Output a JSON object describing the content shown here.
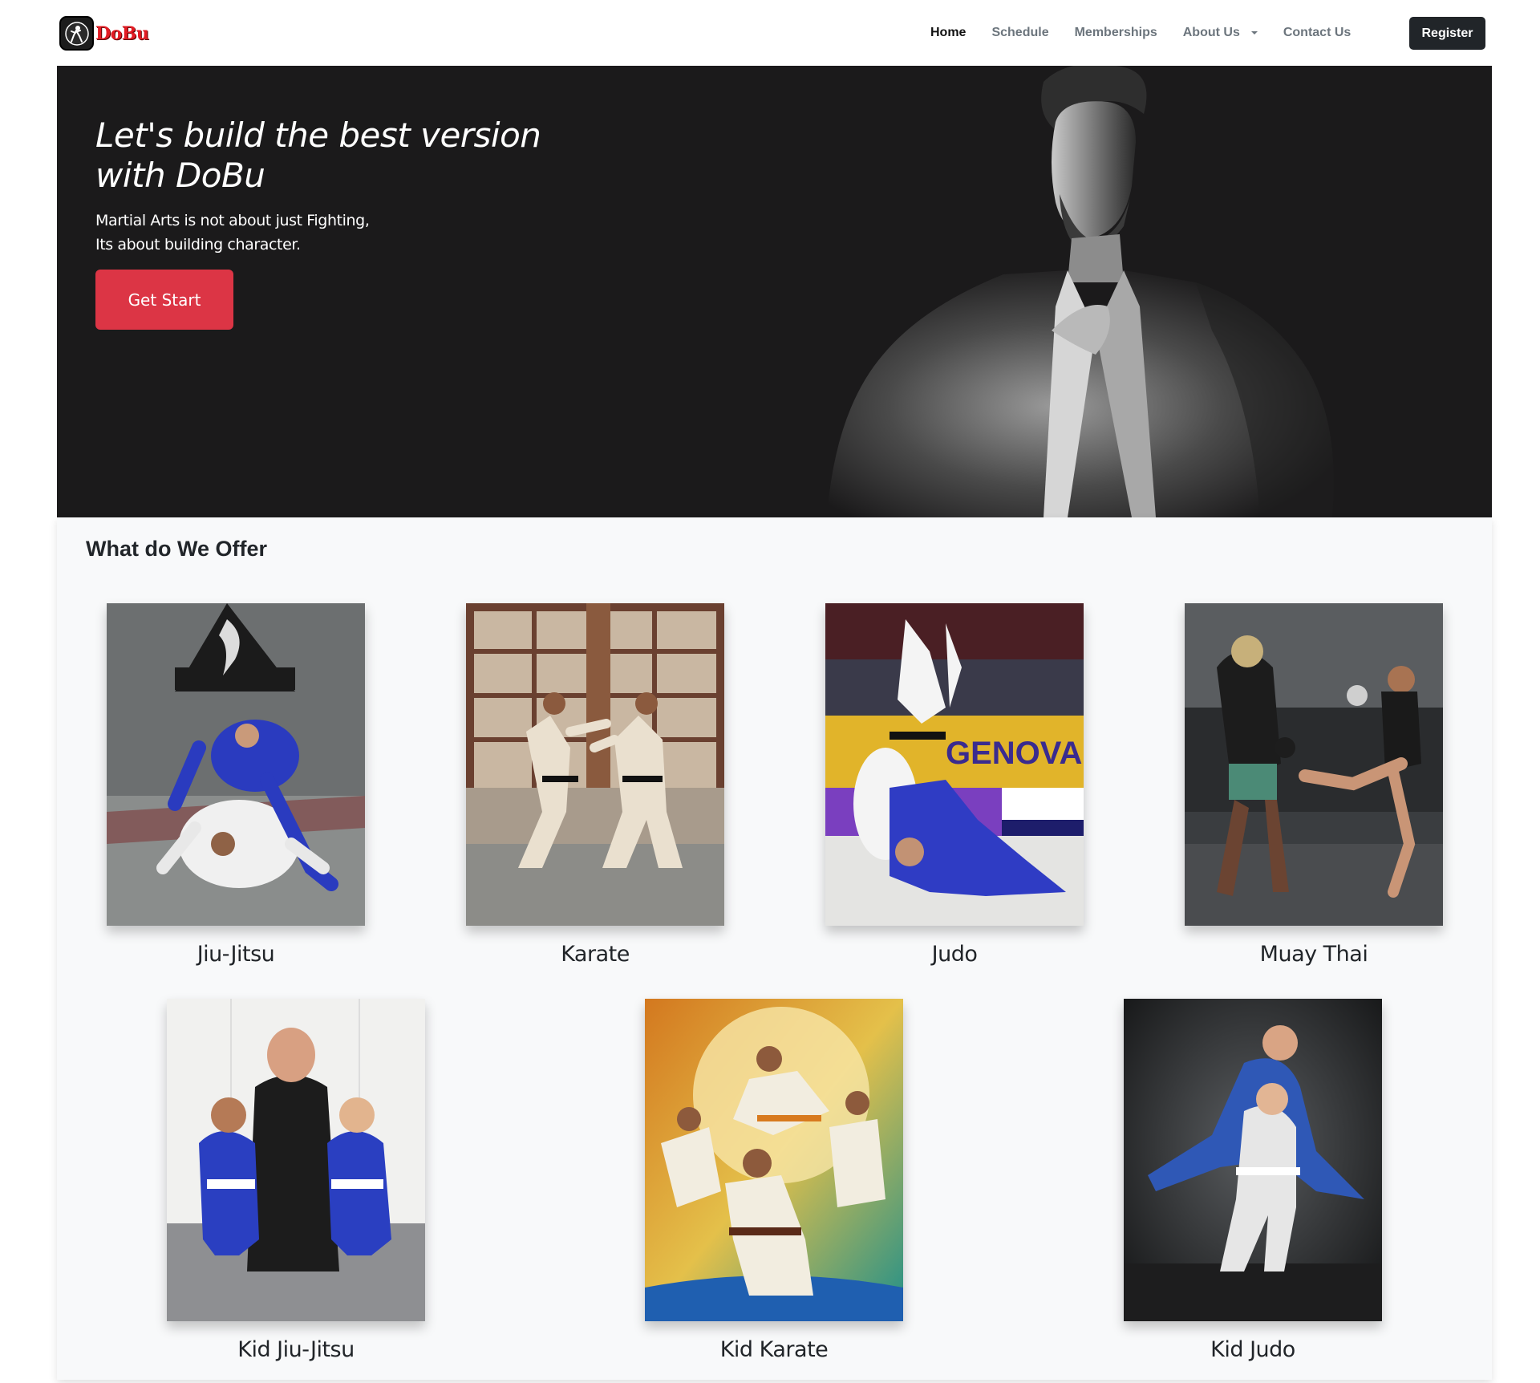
{
  "brand": {
    "name": "DoBu",
    "logo_icon": "fighter-logo-icon"
  },
  "nav": {
    "items": [
      {
        "label": "Home",
        "active": true
      },
      {
        "label": "Schedule",
        "active": false
      },
      {
        "label": "Memberships",
        "active": false
      },
      {
        "label": "About Us",
        "active": false,
        "dropdown": true
      },
      {
        "label": "Contact Us",
        "active": false
      }
    ],
    "register_label": "Register"
  },
  "hero": {
    "title": "Let's build the best version with DoBu",
    "subtitle_line1": "Martial Arts is not about just Fighting,",
    "subtitle_line2": "Its about building character.",
    "cta_label": "Get Start"
  },
  "offer": {
    "title": "What do We Offer",
    "cards": [
      {
        "label": "Jiu-Jitsu"
      },
      {
        "label": "Karate"
      },
      {
        "label": "Judo"
      },
      {
        "label": "Muay Thai"
      },
      {
        "label": "Kid Jiu-Jitsu"
      },
      {
        "label": "Kid Karate"
      },
      {
        "label": "Kid Judo"
      }
    ]
  },
  "colors": {
    "accent": "#dc3545",
    "brand_red": "#e31b23",
    "dark": "#212529",
    "hero_bg": "#1b1a1b",
    "section_bg": "#f8f9fa"
  }
}
